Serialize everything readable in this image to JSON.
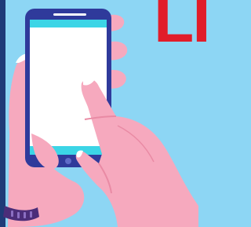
{
  "headline": {
    "text": "LI",
    "color": "#e11d2a"
  },
  "colors": {
    "background": "#8dd6f4",
    "left_stripe": "#1f3b78",
    "phone_frame": "#2f3a9b",
    "screen": "#ffffff",
    "screen_bars": "#3cd5e6",
    "skin": "#f6a9be",
    "skin_shadow": "#e98aa4",
    "nails": "#ffffff",
    "watch_band": "#4b2d79"
  },
  "icons": [
    "phone-icon",
    "home-button-icon",
    "speaker-slot-icon",
    "watch-icon"
  ]
}
